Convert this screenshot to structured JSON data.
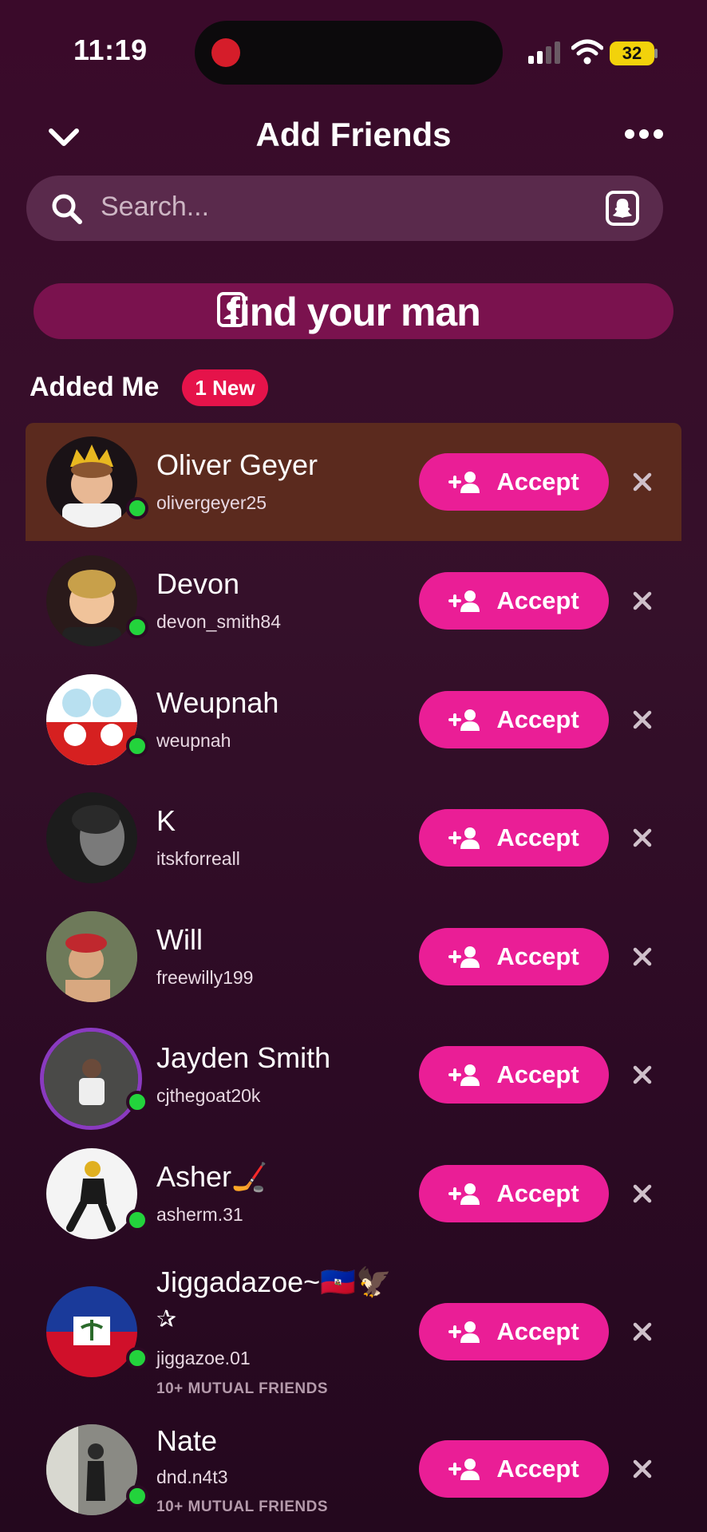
{
  "status": {
    "time": "11:19",
    "battery": "32"
  },
  "header": {
    "title": "Add Friends"
  },
  "search": {
    "placeholder": "Search..."
  },
  "invite": {
    "text": "find your man"
  },
  "section": {
    "title": "Added Me",
    "badge": "1 New"
  },
  "accept_label": "Accept",
  "colors": {
    "accent": "#ea1e96",
    "badge": "#e5134a",
    "online": "#23d33c"
  },
  "requests": [
    {
      "name": "Oliver Geyer",
      "username": "olivergeyer25",
      "mutual": ""
    },
    {
      "name": "Devon",
      "username": "devon_smith84",
      "mutual": ""
    },
    {
      "name": "Weupnah",
      "username": "weupnah",
      "mutual": ""
    },
    {
      "name": "K",
      "username": "itskforreall",
      "mutual": ""
    },
    {
      "name": "Will",
      "username": "freewilly199",
      "mutual": ""
    },
    {
      "name": "Jayden Smith",
      "username": "cjthegoat20k",
      "mutual": ""
    },
    {
      "name": "Asher🏒",
      "username": "asherm.31",
      "mutual": ""
    },
    {
      "name": "Jiggadazoe~🇭🇹🦅",
      "name_line2": "✰",
      "username": "jiggazoe.01",
      "mutual": "10+ MUTUAL FRIENDS"
    },
    {
      "name": "Nate",
      "username": "dnd.n4t3",
      "mutual": "10+ MUTUAL FRIENDS"
    }
  ]
}
